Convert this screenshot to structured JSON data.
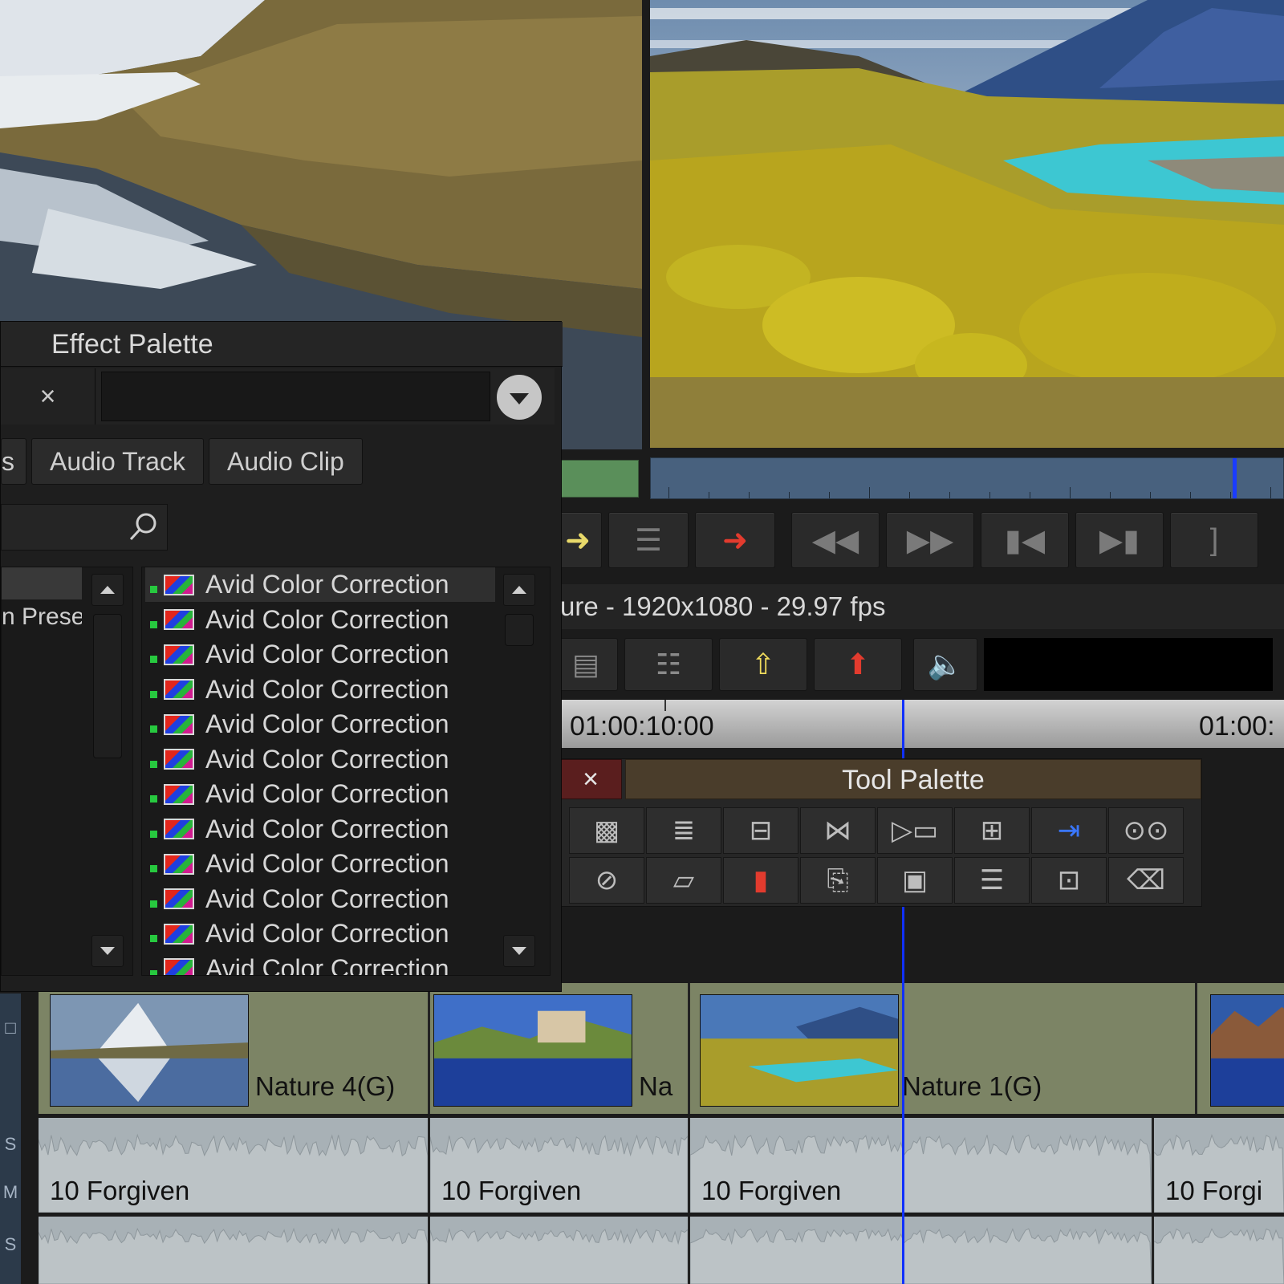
{
  "effect_palette": {
    "title": "Effect Palette",
    "close_symbol": "×",
    "tabs": [
      "s",
      "Audio Track",
      "Audio Clip"
    ],
    "categories": [
      "",
      "n Prese"
    ],
    "effects": [
      "Avid Color Correction",
      "Avid Color Correction",
      "Avid Color Correction",
      "Avid Color Correction",
      "Avid Color Correction",
      "Avid Color Correction",
      "Avid Color Correction",
      "Avid Color Correction",
      "Avid Color Correction",
      "Avid Color Correction",
      "Avid Color Correction",
      "Avid Color Correction"
    ],
    "effect_icon": "color-correction-icon",
    "search_icon": "magnifier-icon",
    "dropdown_icon": "chevron-down-circle-icon"
  },
  "record": {
    "sequence_title": "ure - 1920x1080 - 29.97 fps",
    "timecodes": [
      "01:00:10:00",
      "01:00:"
    ],
    "transport_icons": [
      "overwrite-icon",
      "extract-icon",
      "rewind-icon",
      "fast-forward-icon",
      "step-back-icon",
      "step-forward-icon",
      "mark-out-icon"
    ],
    "timeline_tool_icons": [
      "single-row-icon",
      "splice-icon",
      "lift-icon",
      "extract-icon",
      "audio-speaker-icon"
    ]
  },
  "tool_palette": {
    "title": "Tool Palette",
    "close_symbol": "×",
    "buttons": [
      {
        "icon": "effect-mode-icon",
        "glyph": "▩"
      },
      {
        "icon": "segment-mode-icon",
        "glyph": "≣"
      },
      {
        "icon": "splice-in-icon",
        "glyph": "⊟"
      },
      {
        "icon": "trim-icon",
        "glyph": "⋈"
      },
      {
        "icon": "insert-frame-icon",
        "glyph": "▷▭"
      },
      {
        "icon": "quad-split-icon",
        "glyph": "⊞"
      },
      {
        "icon": "overwrite-arrow-icon",
        "glyph": "⇥"
      },
      {
        "icon": "tape-icon",
        "glyph": "⊙⊙"
      },
      {
        "icon": "no-entry-icon",
        "glyph": "⊘"
      },
      {
        "icon": "clip-stack-icon",
        "glyph": "▱"
      },
      {
        "icon": "red-marker-icon",
        "glyph": "▮"
      },
      {
        "icon": "copy-icon",
        "glyph": "⎘"
      },
      {
        "icon": "film-strip-icon",
        "glyph": "▣"
      },
      {
        "icon": "list-icon",
        "glyph": "☰"
      },
      {
        "icon": "subclip-icon",
        "glyph": "⊡"
      },
      {
        "icon": "eraser-icon",
        "glyph": "⌫"
      }
    ]
  },
  "timeline": {
    "video_clips": [
      "Nature 4(G)",
      "Na",
      "Nature 1(G)",
      ""
    ],
    "audio_clips": [
      "10 Forgiven",
      "10 Forgiven",
      "10 Forgiven",
      "10 Forgi"
    ],
    "track_labels": [
      "□",
      "S",
      "M",
      "S"
    ]
  },
  "colors": {
    "video_track": "#7c8465",
    "audio_track": "#a8b1b6",
    "playhead": "#1030ff",
    "selected_green": "#27c93f"
  }
}
